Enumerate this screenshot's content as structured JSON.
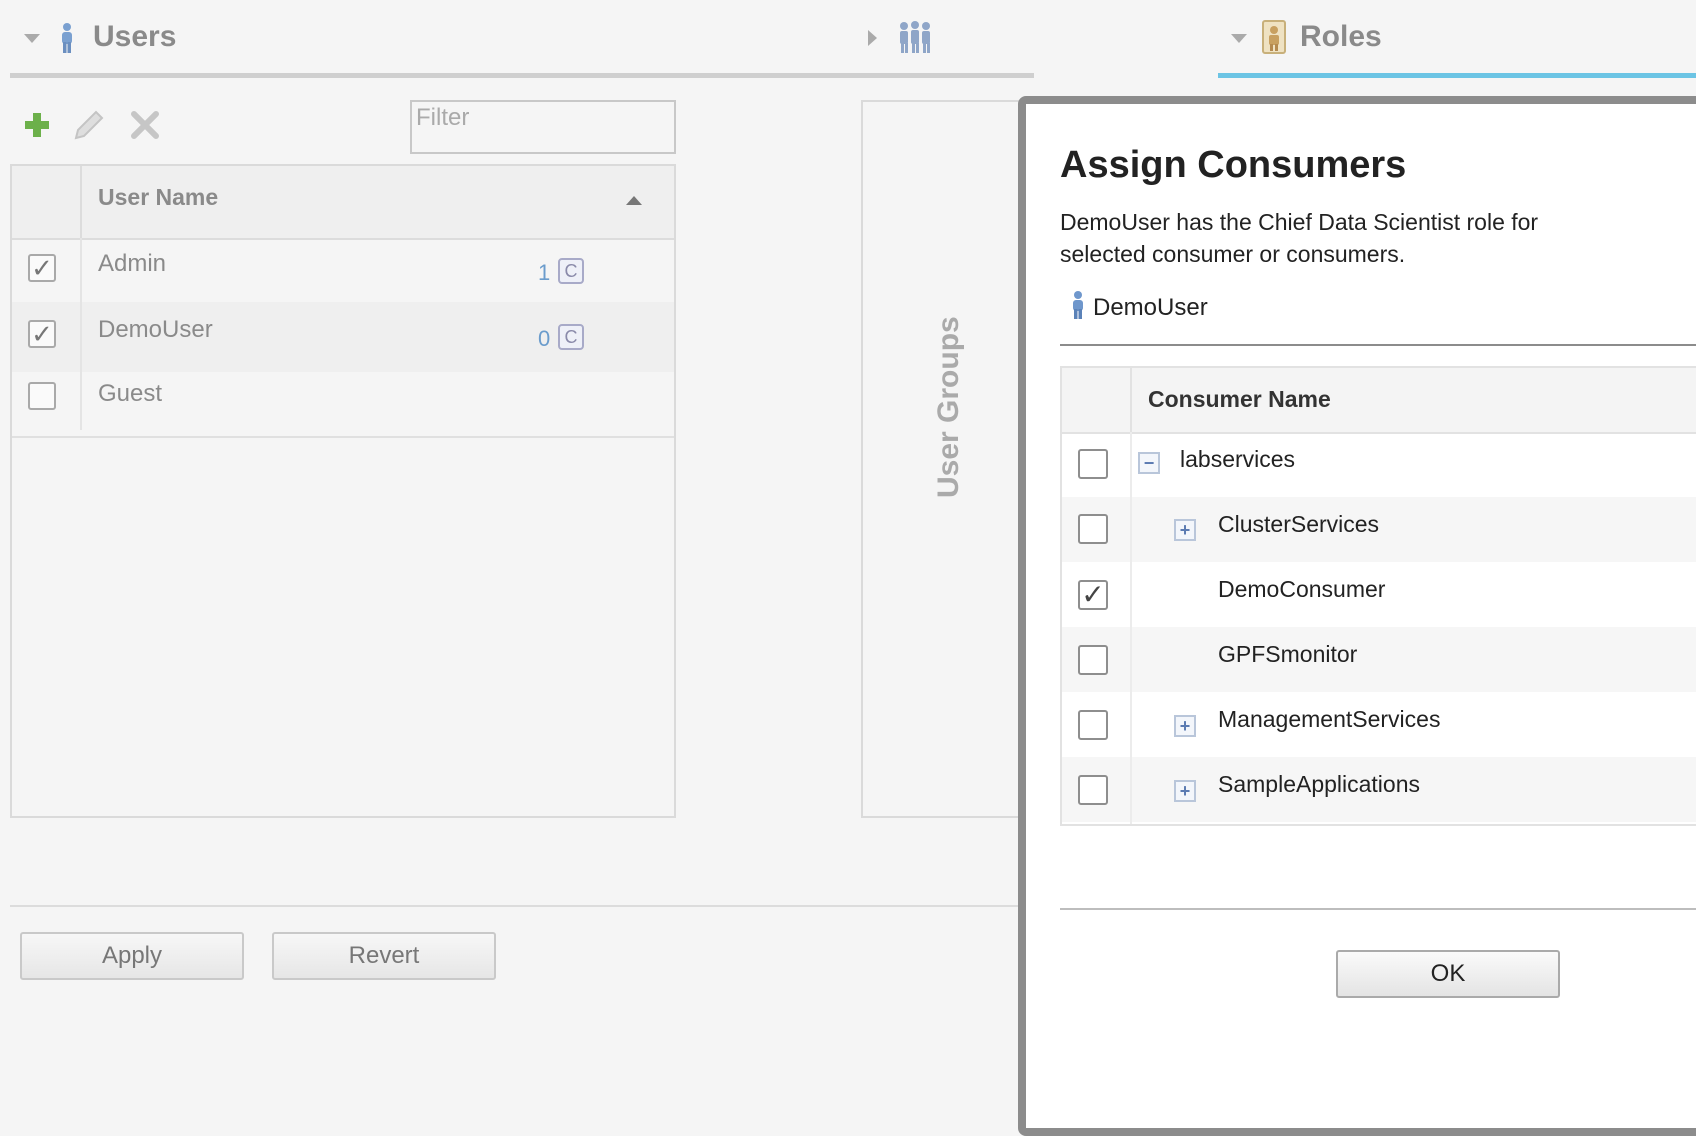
{
  "users_panel": {
    "title": "Users",
    "filter_placeholder": "Filter",
    "toolbar": {
      "add_icon": "plus-icon",
      "edit_icon": "pencil-icon",
      "delete_icon": "x-icon"
    },
    "column_header": "User Name",
    "rows": [
      {
        "name": "Admin",
        "checked": true,
        "count": "1",
        "badge": "C"
      },
      {
        "name": "DemoUser",
        "checked": true,
        "count": "0",
        "badge": "C"
      },
      {
        "name": "Guest",
        "checked": false,
        "count": "",
        "badge": ""
      }
    ],
    "apply_label": "Apply",
    "revert_label": "Revert"
  },
  "user_groups_panel": {
    "label": "User Groups"
  },
  "roles_panel": {
    "title": "Roles",
    "accent_color": "#6cc4e4"
  },
  "dialog": {
    "title": "Assign Consumers",
    "description_line1": "DemoUser has the Chief Data Scientist role for",
    "description_line2": "selected consumer or consumers.",
    "user": "DemoUser",
    "column_header": "Consumer Name",
    "rows": [
      {
        "name": "labservices",
        "checked": false,
        "expander": "−"
      },
      {
        "name": "ClusterServices",
        "checked": false,
        "expander": "+"
      },
      {
        "name": "DemoConsumer",
        "checked": true,
        "expander": ""
      },
      {
        "name": "GPFSmonitor",
        "checked": false,
        "expander": ""
      },
      {
        "name": "ManagementServices",
        "checked": false,
        "expander": "+"
      },
      {
        "name": "SampleApplications",
        "checked": false,
        "expander": "+"
      }
    ],
    "ok_label": "OK"
  }
}
